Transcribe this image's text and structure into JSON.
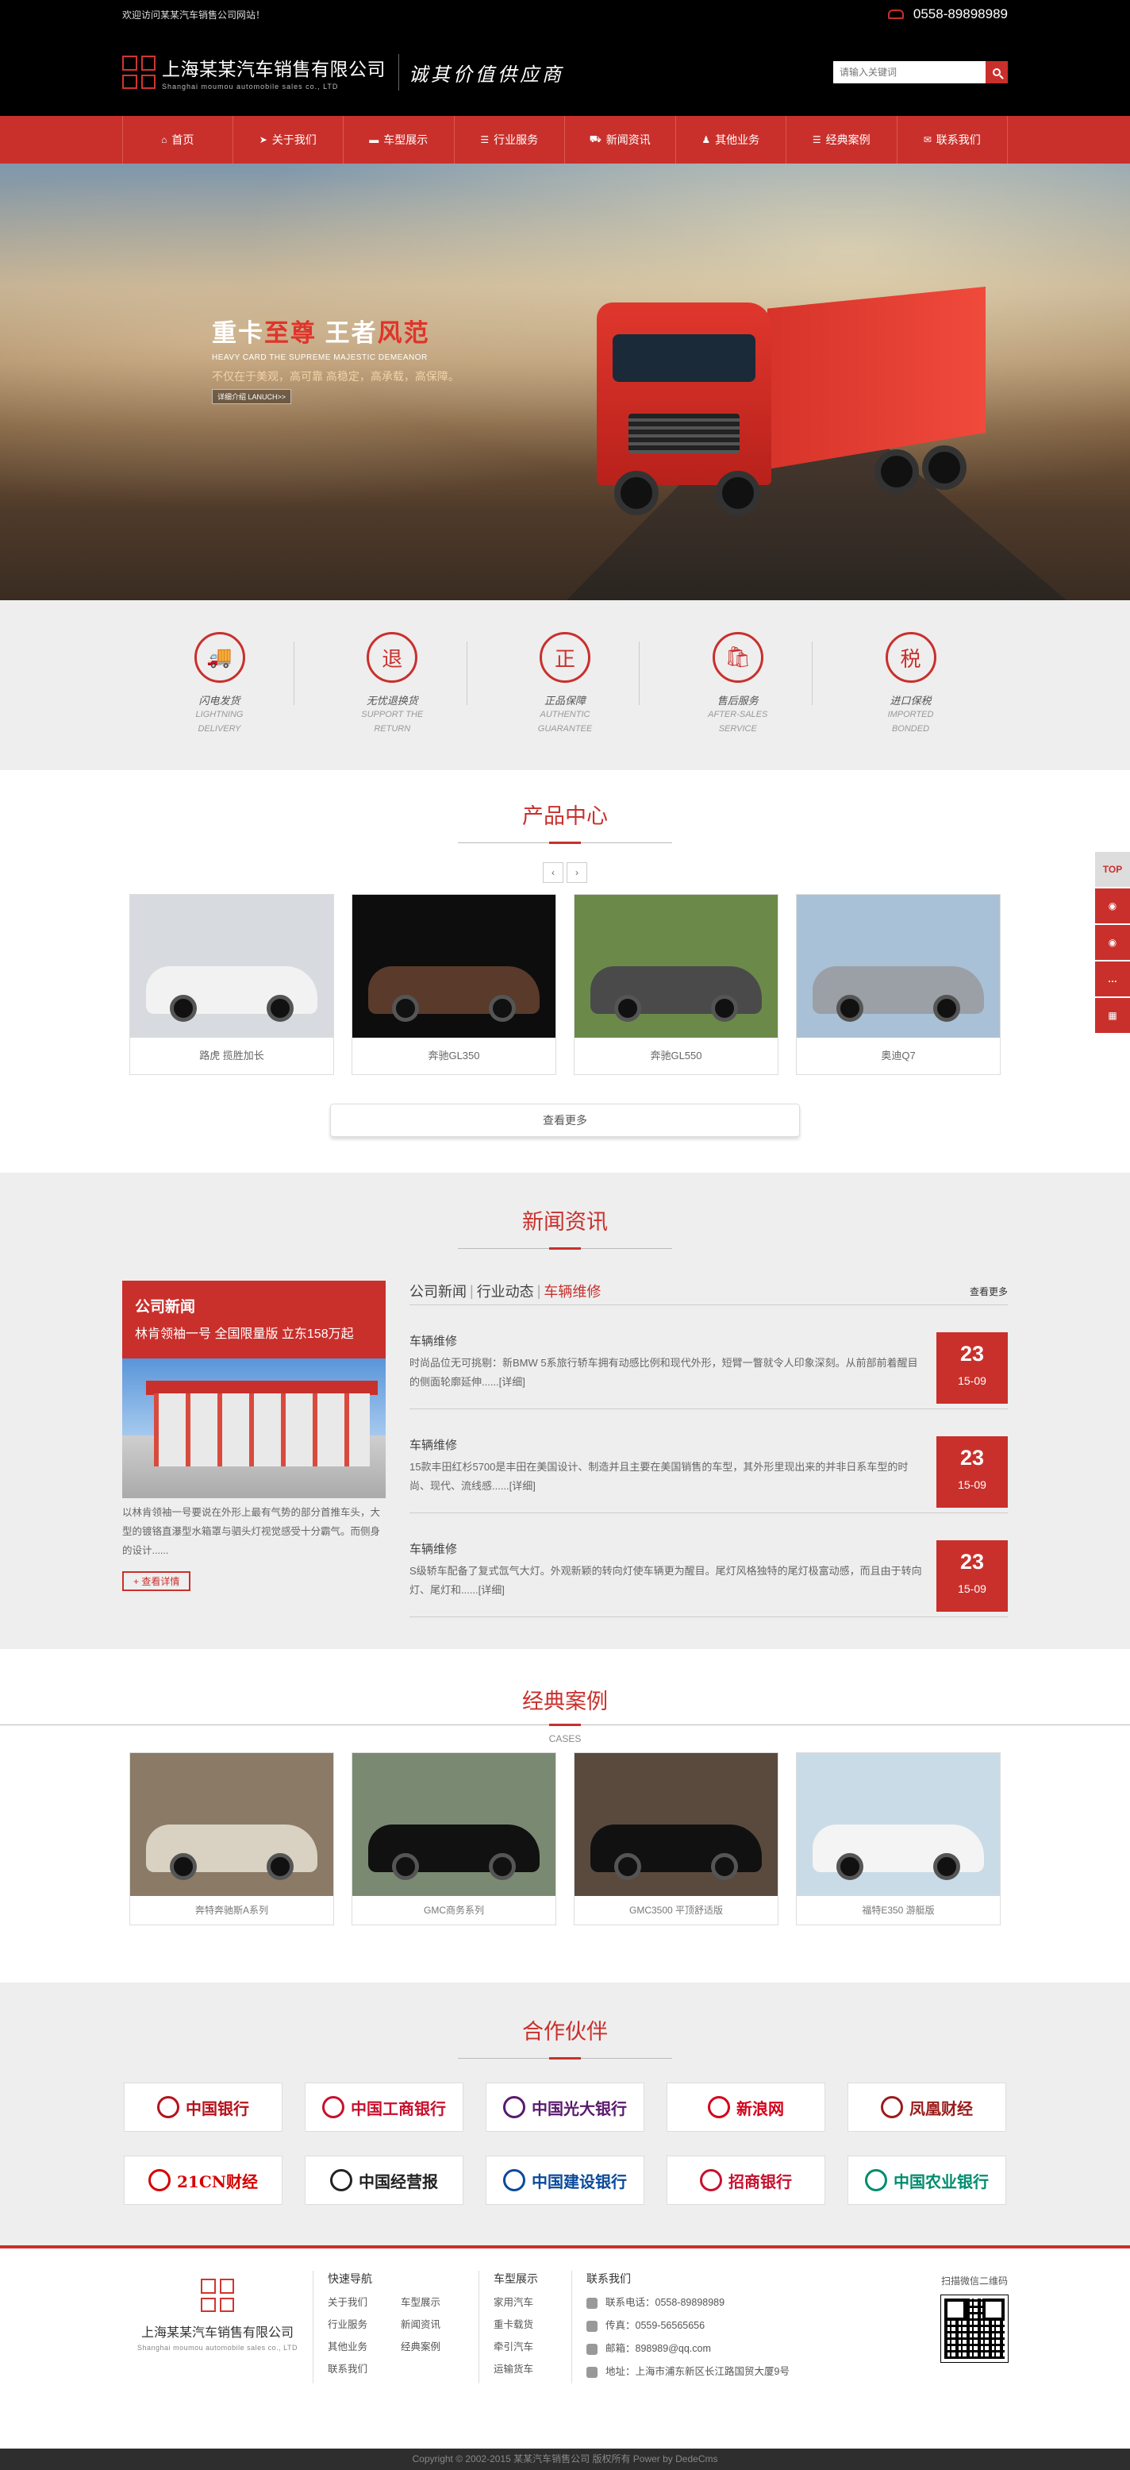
{
  "topbar": {
    "welcome": "欢迎访问某某汽车销售公司网站！",
    "phone": "0558-89898989"
  },
  "header": {
    "company_cn": "上海某某汽车销售有限公司",
    "company_en": "Shanghai moumou automobile sales co., LTD",
    "slogan": "诚其价值供应商",
    "search_placeholder": "请输入关键词"
  },
  "nav": {
    "items": [
      {
        "label": "首页",
        "icon": "home-icon"
      },
      {
        "label": "关于我们",
        "icon": "send-icon"
      },
      {
        "label": "车型展示",
        "icon": "truck-icon"
      },
      {
        "label": "行业服务",
        "icon": "list-icon"
      },
      {
        "label": "新闻资讯",
        "icon": "cart-icon"
      },
      {
        "label": "其他业务",
        "icon": "user-icon"
      },
      {
        "label": "经典案例",
        "icon": "list-icon"
      },
      {
        "label": "联系我们",
        "icon": "chat-icon"
      }
    ]
  },
  "banner": {
    "title_a": "重卡",
    "title_b": "至尊",
    "title_c": "王者",
    "title_d": "风范",
    "subtitle_en": "HEAVY CARD THE SUPREME MAJESTIC DEMEANOR",
    "desc": "不仅在于美观，高可靠 高稳定，高承载，高保障。",
    "cta": "详细介绍 LANUCH>>"
  },
  "features": [
    {
      "glyph": "🚚",
      "name": "闪电发货",
      "en1": "LIGHTNING",
      "en2": "DELIVERY",
      "icon": "truck-icon"
    },
    {
      "glyph": "退",
      "name": "无忧退换货",
      "en1": "SUPPORT THE",
      "en2": "RETURN",
      "icon": "return-icon"
    },
    {
      "glyph": "正",
      "name": "正品保障",
      "en1": "AUTHENTIC",
      "en2": "GUARANTEE",
      "icon": "genuine-icon"
    },
    {
      "glyph": "🛍",
      "name": "售后服务",
      "en1": "AFTER-SALES",
      "en2": "SERVICE",
      "icon": "bag-icon"
    },
    {
      "glyph": "税",
      "name": "进口保税",
      "en1": "IMPORTED",
      "en2": "BONDED",
      "icon": "tax-icon"
    }
  ],
  "products": {
    "title": "产品中心",
    "prev": "‹",
    "next": "›",
    "items": [
      {
        "name": "路虎 揽胜加长",
        "bg": "#d7dbe0",
        "car": "#f2f2f2"
      },
      {
        "name": "奔驰GL350",
        "bg": "#0d0d0d",
        "car": "#5a3a2a"
      },
      {
        "name": "奔驰GL550",
        "bg": "#6b8a4a",
        "car": "#4a4a4a"
      },
      {
        "name": "奥迪Q7",
        "bg": "#a9c1d6",
        "car": "#9aa0a6"
      }
    ],
    "more": "查看更多"
  },
  "news": {
    "title": "新闻资讯",
    "feature": {
      "head1": "公司新闻",
      "head2": "林肯领袖一号 全国限量版 立东158万起",
      "text": "以林肯领袖一号要说在外形上最有气势的部分首推车头，大型的镀铬直瀑型水箱罩与驷头灯视觉感受十分霸气。而侧身的设计......",
      "detail": "+ 查看详情"
    },
    "tabs": [
      "公司新闻",
      "行业动态",
      "车辆维修"
    ],
    "sep": "|",
    "more": "查看更多",
    "items": [
      {
        "title": "车辆维修",
        "summary": "时尚品位无可挑剔：新BMW 5系旅行轿车拥有动感比例和现代外形，短臂一瞥就令人印象深刻。从前部前着醒目的侧面轮廓延伸......",
        "link": "[详细]",
        "day": "23",
        "ym": "15-09"
      },
      {
        "title": "车辆维修",
        "summary": "15款丰田红杉5700是丰田在美国设计、制造并且主要在美国销售的车型，其外形里现出来的并非日系车型的时尚、现代、流线感......",
        "link": "[详细]",
        "day": "23",
        "ym": "15-09"
      },
      {
        "title": "车辆维修",
        "summary": "S级轿车配备了复式氙气大灯。外观新颖的转向灯使车辆更为醒目。尾灯风格独特的尾灯极富动感，而且由于转向灯、尾灯和......",
        "link": "[详细]",
        "day": "23",
        "ym": "15-09"
      }
    ]
  },
  "cases": {
    "title": "经典案例",
    "subtitle": "CASES",
    "items": [
      {
        "name": "奔特奔驰斯A系列",
        "bg": "#8a7a66",
        "car": "#d9d2c2"
      },
      {
        "name": "GMC商务系列",
        "bg": "#7a8a72",
        "car": "#111111"
      },
      {
        "name": "GMC3500 平顶舒适版",
        "bg": "#5a4a3e",
        "car": "#111111"
      },
      {
        "name": "福特E350 游艇版",
        "bg": "#c9dbe6",
        "car": "#f4f4f4"
      }
    ]
  },
  "partners": {
    "title": "合作伙伴",
    "items": [
      {
        "name": "中国银行",
        "color": "#b5121b"
      },
      {
        "name": "中国工商银行",
        "color": "#c8102e"
      },
      {
        "name": "中国光大银行",
        "color": "#5a1a6e"
      },
      {
        "name": "新浪网",
        "color": "#d4001a"
      },
      {
        "name": "凤凰财经",
        "color": "#9b1c1c"
      },
      {
        "name": "21CN财经",
        "color": "#d60000"
      },
      {
        "name": "中国经营报",
        "color": "#222222"
      },
      {
        "name": "中国建设银行",
        "color": "#0a4a9c"
      },
      {
        "name": "招商银行",
        "color": "#c8102e"
      },
      {
        "name": "中国农业银行",
        "color": "#008c6e"
      }
    ]
  },
  "footer": {
    "company_cn": "上海某某汽车销售有限公司",
    "company_en": "Shanghai moumou automobile sales co., LTD",
    "quick_nav_title": "快速导航",
    "quick_nav": [
      "关于我们",
      "车型展示",
      "行业服务",
      "新闻资讯",
      "其他业务",
      "经典案例",
      "联系我们"
    ],
    "models_title": "车型展示",
    "models": [
      "家用汽车",
      "重卡载货",
      "牵引汽车",
      "运输货车"
    ],
    "contact_title": "联系我们",
    "contacts": [
      {
        "label": "联系电话：0558-89898989",
        "icon": "phone-icon"
      },
      {
        "label": "传真：0559-56565656",
        "icon": "fax-icon"
      },
      {
        "label": "邮箱：898989@qq.com",
        "icon": "mail-icon"
      },
      {
        "label": "地址：上海市浦东新区长江路国贸大厦9号",
        "icon": "location-icon"
      }
    ],
    "qr_label": "扫描微信二维码",
    "copyright": "Copyright © 2002-2015 某某汽车销售公司 版权所有 Power by DedeCms"
  },
  "side": {
    "top": "TOP"
  }
}
